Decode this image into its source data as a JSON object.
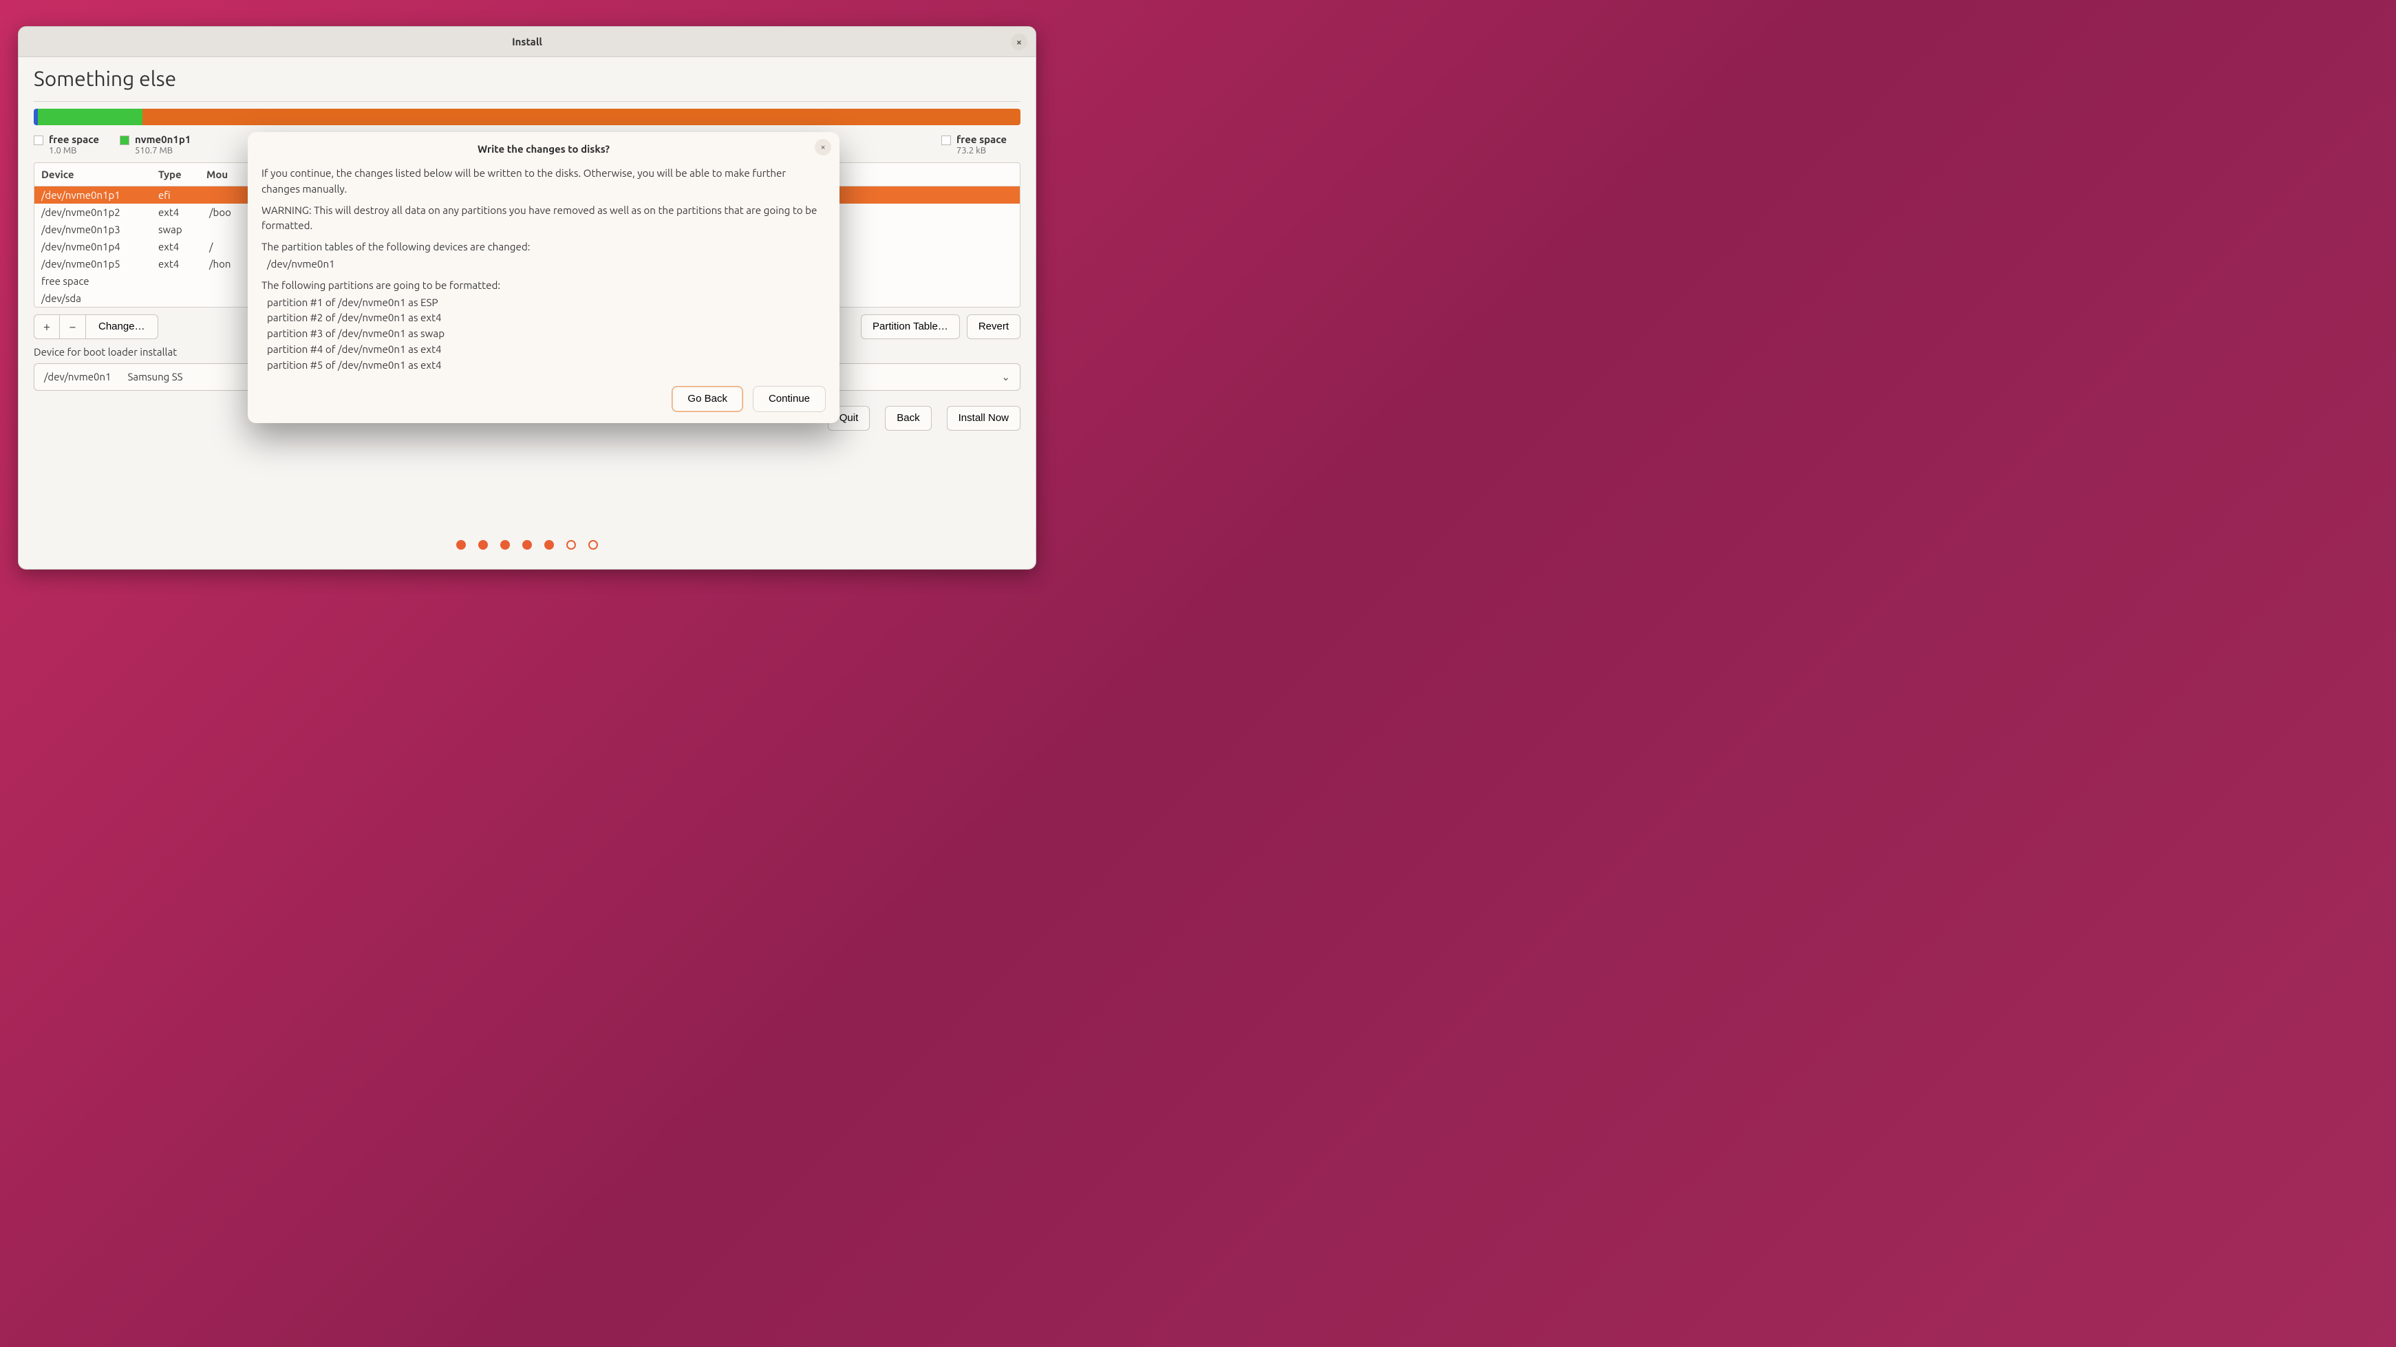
{
  "window": {
    "title": "Install",
    "page_heading": "Something else",
    "close_label": "×"
  },
  "legend": {
    "left": {
      "name": "free space",
      "size": "1.0 MB"
    },
    "green": {
      "name": "nvme0n1p1",
      "size": "510.7 MB"
    },
    "right": {
      "name": "free space",
      "size": "73.2 kB"
    }
  },
  "table": {
    "headers": {
      "device": "Device",
      "type": "Type",
      "mount": "Mou"
    },
    "rows": [
      {
        "device": "/dev/nvme0n1p1",
        "type": "efi",
        "mount": "",
        "selected": true
      },
      {
        "device": "/dev/nvme0n1p2",
        "type": "ext4",
        "mount": "/boo"
      },
      {
        "device": "/dev/nvme0n1p3",
        "type": "swap",
        "mount": ""
      },
      {
        "device": "/dev/nvme0n1p4",
        "type": "ext4",
        "mount": "/"
      },
      {
        "device": "/dev/nvme0n1p5",
        "type": "ext4",
        "mount": "/hon"
      },
      {
        "device": "free space",
        "type": "",
        "mount": ""
      },
      {
        "device": "/dev/sda",
        "type": "",
        "mount": ""
      }
    ]
  },
  "toolbar": {
    "add": "+",
    "remove": "−",
    "change": "Change…",
    "new_table": "Partition Table…",
    "revert": "Revert"
  },
  "boot": {
    "label": "Device for boot loader installat",
    "device": "/dev/nvme0n1",
    "model": "Samsung SS"
  },
  "nav": {
    "quit": "Quit",
    "back": "Back",
    "install": "Install Now"
  },
  "progress": {
    "total": 7,
    "current": 5
  },
  "modal": {
    "title": "Write the changes to disks?",
    "close": "×",
    "p1": "If you continue, the changes listed below will be written to the disks. Otherwise, you will be able to make further changes manually.",
    "p2": "WARNING: This will destroy all data on any partitions you have removed as well as on the partitions that are going to be formatted.",
    "p3": "The partition tables of the following devices are changed:",
    "devices": [
      "/dev/nvme0n1"
    ],
    "p4": "The following partitions are going to be formatted:",
    "formats": [
      "partition #1 of /dev/nvme0n1 as ESP",
      "partition #2 of /dev/nvme0n1 as ext4",
      "partition #3 of /dev/nvme0n1 as swap",
      "partition #4 of /dev/nvme0n1 as ext4",
      "partition #5 of /dev/nvme0n1 as ext4"
    ],
    "go_back": "Go Back",
    "continue": "Continue"
  }
}
